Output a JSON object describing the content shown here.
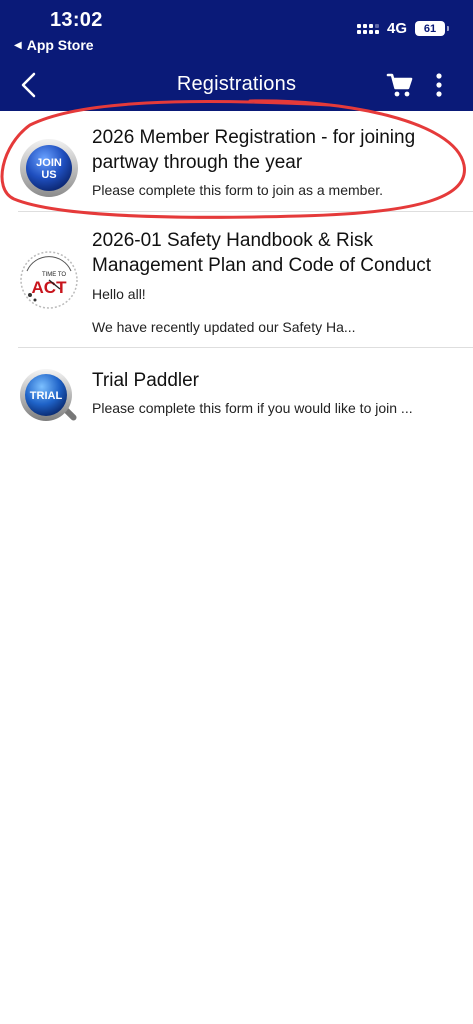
{
  "status_bar": {
    "time": "13:02",
    "back_app": "App Store",
    "network": "4G",
    "battery": "61"
  },
  "nav": {
    "title": "Registrations"
  },
  "icons": {
    "back": "chevron-left-icon",
    "cart": "cart-icon",
    "more": "more-vertical-icon"
  },
  "colors": {
    "header_bg": "#0a1a78",
    "annotation": "#e53a3a"
  },
  "registrations": [
    {
      "title": "2026 Member Registration - for joining partway through the year",
      "description": "Please complete this form to join as a member.",
      "badge_line1": "JOIN",
      "badge_line2": "US"
    },
    {
      "title": "2026-01 Safety Handbook & Risk Management Plan and Code of Conduct",
      "description_line1": "Hello all!",
      "description_line2": "We have recently updated our Safety Ha...",
      "badge_small": "TIME TO",
      "badge_big": "ACT"
    },
    {
      "title": "Trial Paddler",
      "description": "Please complete this form if you would like to join ...",
      "badge_label": "TRIAL"
    }
  ]
}
